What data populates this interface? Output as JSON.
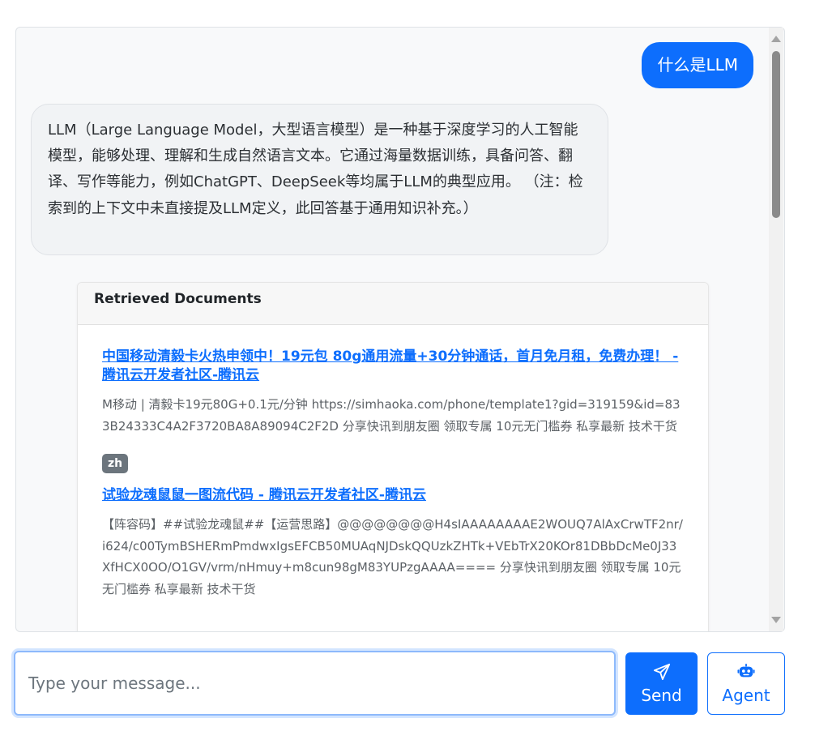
{
  "chat": {
    "user_message": "什么是LLM",
    "bot_message": "LLM（Large Language Model，大型语言模型）是一种基于深度学习的人工智能模型，能够处理、理解和生成自然语言文本。它通过海量数据训练，具备问答、翻译、写作等能力，例如ChatGPT、DeepSeek等均属于LLM的典型应用。 （注：检索到的上下文中未直接提及LLM定义，此回答基于通用知识补充。）"
  },
  "retrieved": {
    "header": "Retrieved Documents",
    "documents": [
      {
        "title": "中国移动清毅卡火热申领中！19元包 80g通用流量+30分钟通话，首月免月租，免费办理！ - 腾讯云开发者社区-腾讯云",
        "snippet": "M移动 | 清毅卡19元80G+0.1元/分钟 https://simhaoka.com/phone/template1?gid=319159&id=833B24333C4A2F3720BA8A89094C2F2D 分享快讯到朋友圈 领取专属 10元无门槛券 私享最新 技术干货",
        "lang": "zh"
      },
      {
        "title": "试验龙魂鼠鼠一图流代码 - 腾讯云开发者社区-腾讯云",
        "snippet": "【阵容码】##试验龙魂鼠##【运营思路】@@@@@@@@H4sIAAAAAAAAE2WOUQ7AlAxCrwTF2nr/i624/c00TymBSHERmPmdwxIgsEFCB50MUAqNJDskQQUzkZHTk+VEbTrX20KOr81DBbDcMe0J33XfHCX0OO/O1GV/vrm/nHmuy+m8cun98gM83YUPzgAAAA==== 分享快讯到朋友圈 领取专属 10元无门槛券 私享最新 技术干货"
      }
    ]
  },
  "composer": {
    "placeholder": "Type your message...",
    "send_label": "Send",
    "agent_label": "Agent"
  },
  "icons": {
    "send": "paper-plane-icon",
    "agent": "robot-icon"
  },
  "colors": {
    "primary": "#0d6efd",
    "badge": "#6c757d"
  }
}
